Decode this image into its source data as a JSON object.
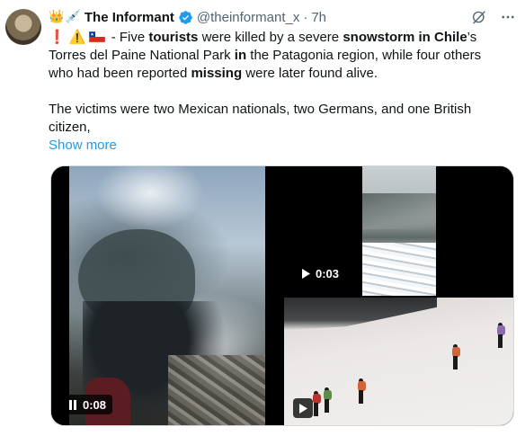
{
  "tweet": {
    "author": {
      "emoji_prefix": [
        "👑",
        "💉"
      ],
      "name": "The Informant",
      "verified": true,
      "handle": "@theinformant_x",
      "separator": "·",
      "time": "7h"
    },
    "text_lines": [
      {
        "parts": [
          {
            "text": "❗",
            "style": "mark"
          },
          {
            "text": " "
          },
          {
            "text": "⚠️",
            "style": "warn"
          },
          {
            "flag": "chile"
          },
          {
            "text": " - Five "
          },
          {
            "text": "tourists",
            "bold": true
          },
          {
            "text": " were killed by a severe "
          },
          {
            "text": "snowstorm in Chile",
            "bold": true
          },
          {
            "text": "’s"
          }
        ]
      },
      {
        "parts": [
          {
            "text": "Torres del Paine National Park "
          },
          {
            "text": "in",
            "bold": true
          },
          {
            "text": " the Patagonia region, while four others"
          }
        ]
      },
      {
        "parts": [
          {
            "text": "who had been reported "
          },
          {
            "text": "missing",
            "bold": true
          },
          {
            "text": " were later found alive."
          }
        ]
      },
      {
        "gap": true
      },
      {
        "parts": [
          {
            "text": "The victims were two Mexican nationals, two Germans, and one British"
          }
        ]
      },
      {
        "parts": [
          {
            "text": "citizen,"
          }
        ]
      }
    ],
    "show_more": "Show more",
    "media": [
      {
        "kind": "video",
        "state": "playing",
        "duration": "0:08"
      },
      {
        "kind": "video",
        "state": "paused",
        "duration": "0:03"
      },
      {
        "kind": "video",
        "state": "paused",
        "duration": ""
      }
    ]
  },
  "colors": {
    "link": "#1d9bf0",
    "secondary_text": "#536471",
    "verified_badge": "#1d9bf0",
    "overlay": "rgba(0,0,0,0.77)"
  },
  "icons": {
    "header_right": [
      "grok-icon",
      "more-icon"
    ],
    "media_controls": [
      "pause-icon",
      "play-icon",
      "play-icon"
    ]
  }
}
